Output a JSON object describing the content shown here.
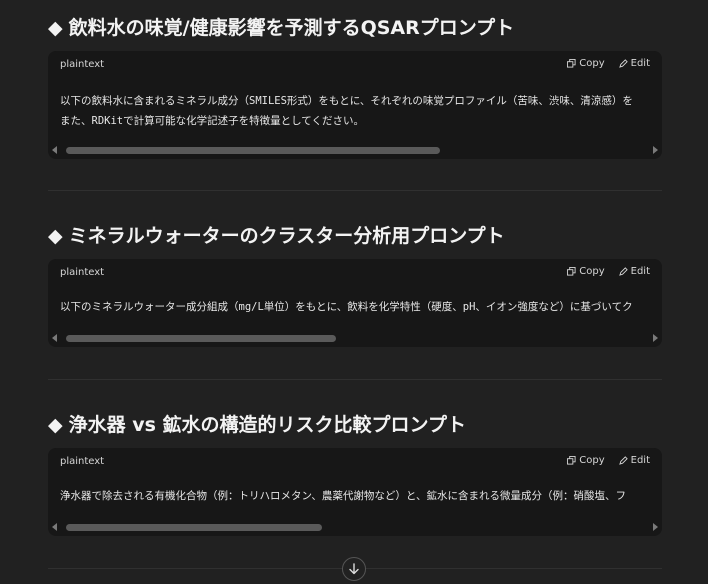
{
  "sections": [
    {
      "title": "飲料水の味覚/健康影響を予測するQSARプロンプト",
      "code_lang": "plaintext",
      "copy_label": "Copy",
      "edit_label": "Edit",
      "code_lines": [
        "以下の飲料水に含まれるミネラル成分（SMILES形式）をもとに、それぞれの味覚プロファイル（苦味、渋味、清涼感）を",
        "また、RDKitで計算可能な化学記述子を特徴量としてください。"
      ]
    },
    {
      "title": "ミネラルウォーターのクラスター分析用プロンプト",
      "code_lang": "plaintext",
      "copy_label": "Copy",
      "edit_label": "Edit",
      "code_lines": [
        "以下のミネラルウォーター成分組成（mg/L単位）をもとに、飲料を化学特性（硬度、pH、イオン強度など）に基づいてク"
      ]
    },
    {
      "title": "浄水器 vs 鉱水の構造的リスク比較プロンプト",
      "code_lang": "plaintext",
      "copy_label": "Copy",
      "edit_label": "Edit",
      "code_lines": [
        "浄水器で除去される有機化合物（例：トリハロメタン、農薬代謝物など）と、鉱水に含まれる微量成分（例：硝酸塩、フ"
      ]
    }
  ],
  "icons": {
    "bullet": "diamond-bullet",
    "copy": "copy-icon",
    "edit": "edit-icon",
    "scroll_down": "arrow-down-icon"
  },
  "colors": {
    "background": "#212121",
    "code_background": "#171717",
    "text": "#ececec"
  }
}
